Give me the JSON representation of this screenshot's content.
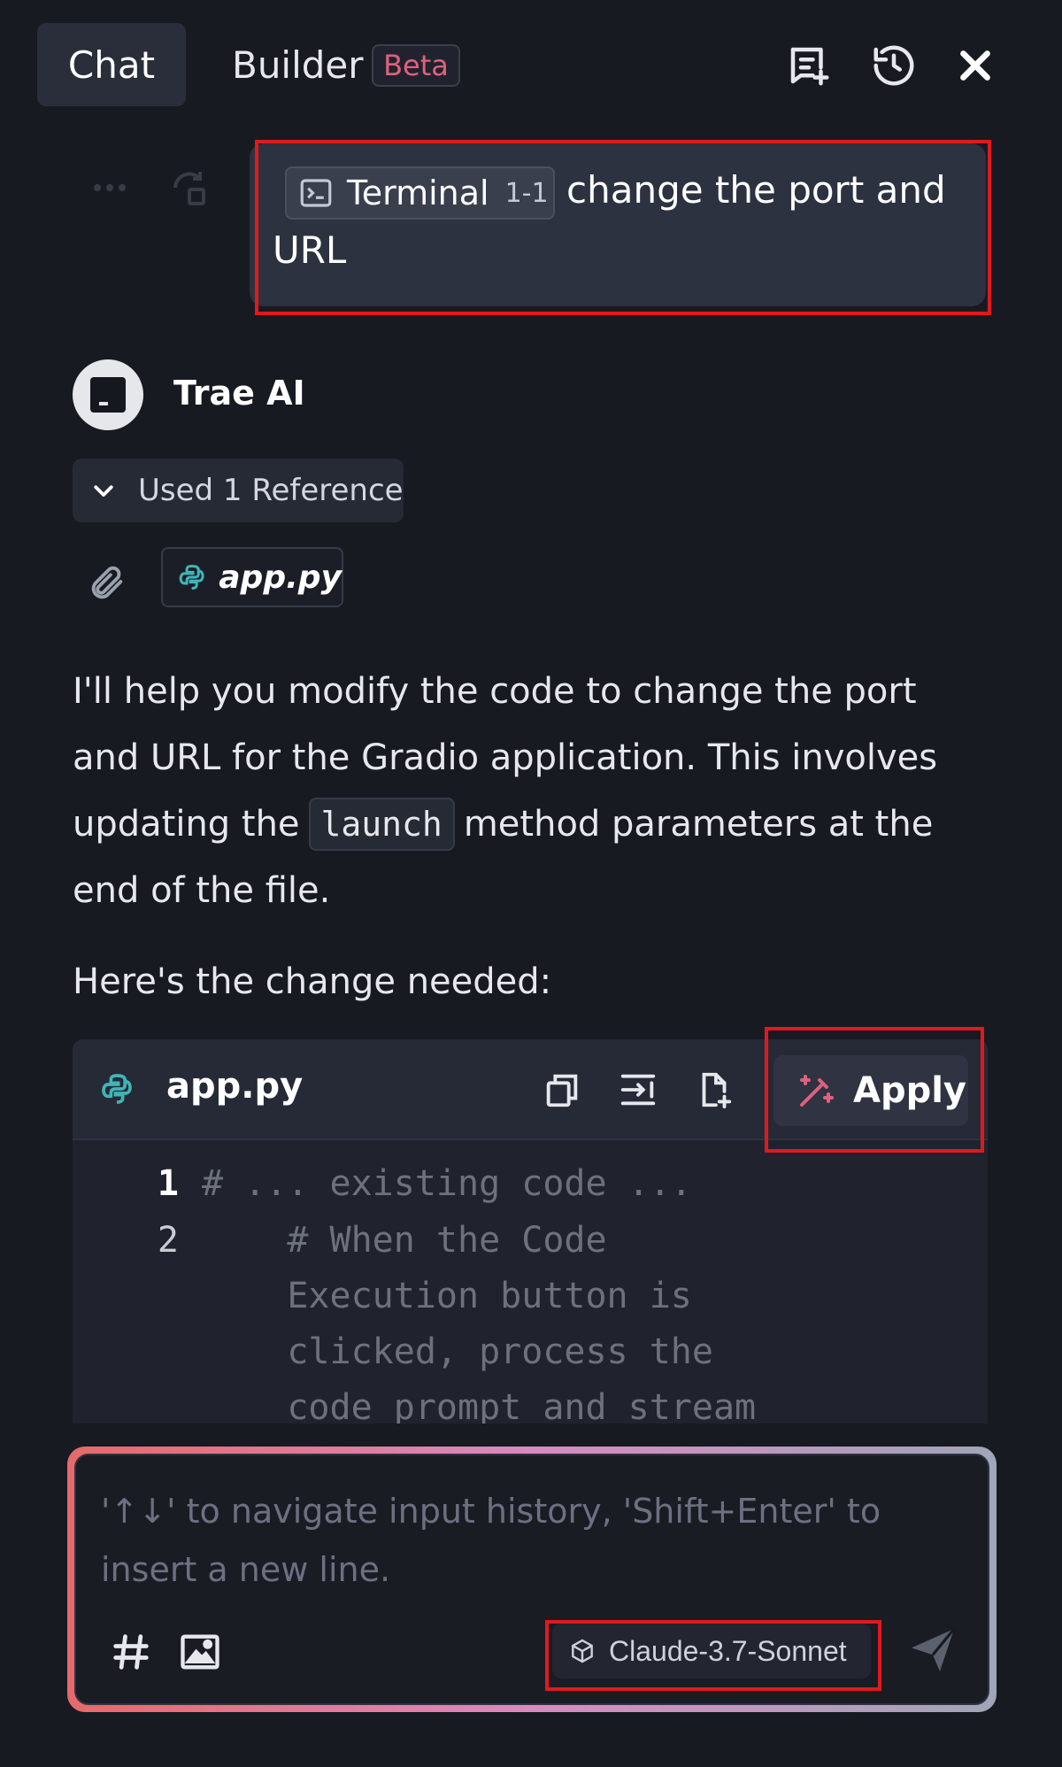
{
  "header": {
    "tabs": [
      {
        "label": "Chat",
        "active": true
      },
      {
        "label": "Builder",
        "badge": "Beta"
      }
    ],
    "icons": [
      "new-chat-icon",
      "history-icon",
      "close-icon"
    ]
  },
  "user_message": {
    "chip_label": "Terminal",
    "chip_range": "1-1",
    "text_line1": "change the port and",
    "text_line2": "URL"
  },
  "assistant": {
    "name": "Trae AI",
    "references_toggle": "Used 1 Reference",
    "reference_file": "app.py",
    "para1_before": "I'll help you modify the code to change the port and URL for the Gradio application. This involves updating the",
    "para1_code": "launch",
    "para1_after": "method parameters at the end of the file.",
    "para2": "Here's the change needed:"
  },
  "code_block": {
    "filename": "app.py",
    "apply_label": "Apply",
    "toolbar_icons": [
      "copy-icon",
      "insert-icon",
      "new-file-icon",
      "apply-icon"
    ],
    "lines": [
      {
        "number": "1",
        "text": "# ... existing code ..."
      },
      {
        "number": "2",
        "text": "    # When the Code"
      },
      {
        "number": "",
        "text": "    Execution button is"
      },
      {
        "number": "",
        "text": "    clicked, process the"
      },
      {
        "number": "",
        "text": "    code prompt and stream"
      }
    ]
  },
  "input": {
    "placeholder": "'↑↓' to navigate input history, 'Shift+Enter' to insert a new line.",
    "model": "Claude-3.7-Sonnet"
  },
  "colors": {
    "background": "#181a22",
    "accent_pink": "#e0607f",
    "highlight_red": "#e0191f",
    "python_teal": "#3fb6b6"
  }
}
